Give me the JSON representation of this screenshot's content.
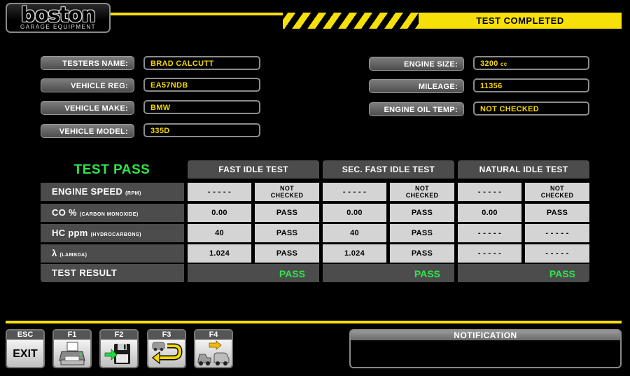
{
  "brand": {
    "name": "boston",
    "tagline": "GARAGE EQUIPMENT"
  },
  "header": {
    "title": "TEST COMPLETED"
  },
  "info": {
    "testers_name": {
      "label": "TESTERS NAME:",
      "value": "BRAD CALCUTT"
    },
    "vehicle_reg": {
      "label": "VEHICLE REG:",
      "value": "EA57NDB"
    },
    "vehicle_make": {
      "label": "VEHICLE MAKE:",
      "value": "BMW"
    },
    "vehicle_model": {
      "label": "VEHICLE MODEL:",
      "value": "335D"
    },
    "engine_size": {
      "label": "ENGINE SIZE:",
      "value": "3200",
      "unit": "cc"
    },
    "mileage": {
      "label": "MILEAGE:",
      "value": "11356"
    },
    "engine_oil_temp": {
      "label": "ENGINE OIL TEMP:",
      "value": "NOT CHECKED"
    }
  },
  "results": {
    "overall": "TEST PASS",
    "columns": [
      "FAST IDLE TEST",
      "SEC. FAST IDLE TEST",
      "NATURAL IDLE TEST"
    ],
    "rows": [
      {
        "label": "ENGINE SPEED",
        "sub": "(RPM)",
        "cells": [
          [
            "- - - - -",
            "NOT",
            "CHECKED"
          ],
          [
            "- - - - -",
            "NOT",
            "CHECKED"
          ],
          [
            "- - - - -",
            "NOT",
            "CHECKED"
          ]
        ]
      },
      {
        "label": "CO %",
        "sub": "(CARBON MONOXIDE)",
        "cells": [
          [
            "0.00",
            "PASS"
          ],
          [
            "0.00",
            "PASS"
          ],
          [
            "0.00",
            "PASS"
          ]
        ]
      },
      {
        "label": "HC ppm",
        "sub": "(HYDROCARBONS)",
        "cells": [
          [
            "40",
            "PASS"
          ],
          [
            "40",
            "PASS"
          ],
          [
            "- - - - -",
            "- - - - -"
          ]
        ]
      },
      {
        "label": "λ",
        "sub": "(LAMBDA)",
        "cells": [
          [
            "1.024",
            "PASS"
          ],
          [
            "1.024",
            "PASS"
          ],
          [
            "- - - - -",
            "- - - - -"
          ]
        ]
      }
    ],
    "result_label": "TEST RESULT",
    "result_values": [
      "PASS",
      "PASS",
      "PASS"
    ]
  },
  "function_keys": [
    {
      "key": "ESC",
      "label": "EXIT",
      "icon": "exit"
    },
    {
      "key": "F1",
      "icon": "printer-icon"
    },
    {
      "key": "F2",
      "icon": "save-disk-icon"
    },
    {
      "key": "F3",
      "icon": "back-arrow-icon"
    },
    {
      "key": "F4",
      "icon": "car-transfer-icon"
    }
  ],
  "notification": {
    "title": "NOTIFICATION",
    "message": ""
  }
}
